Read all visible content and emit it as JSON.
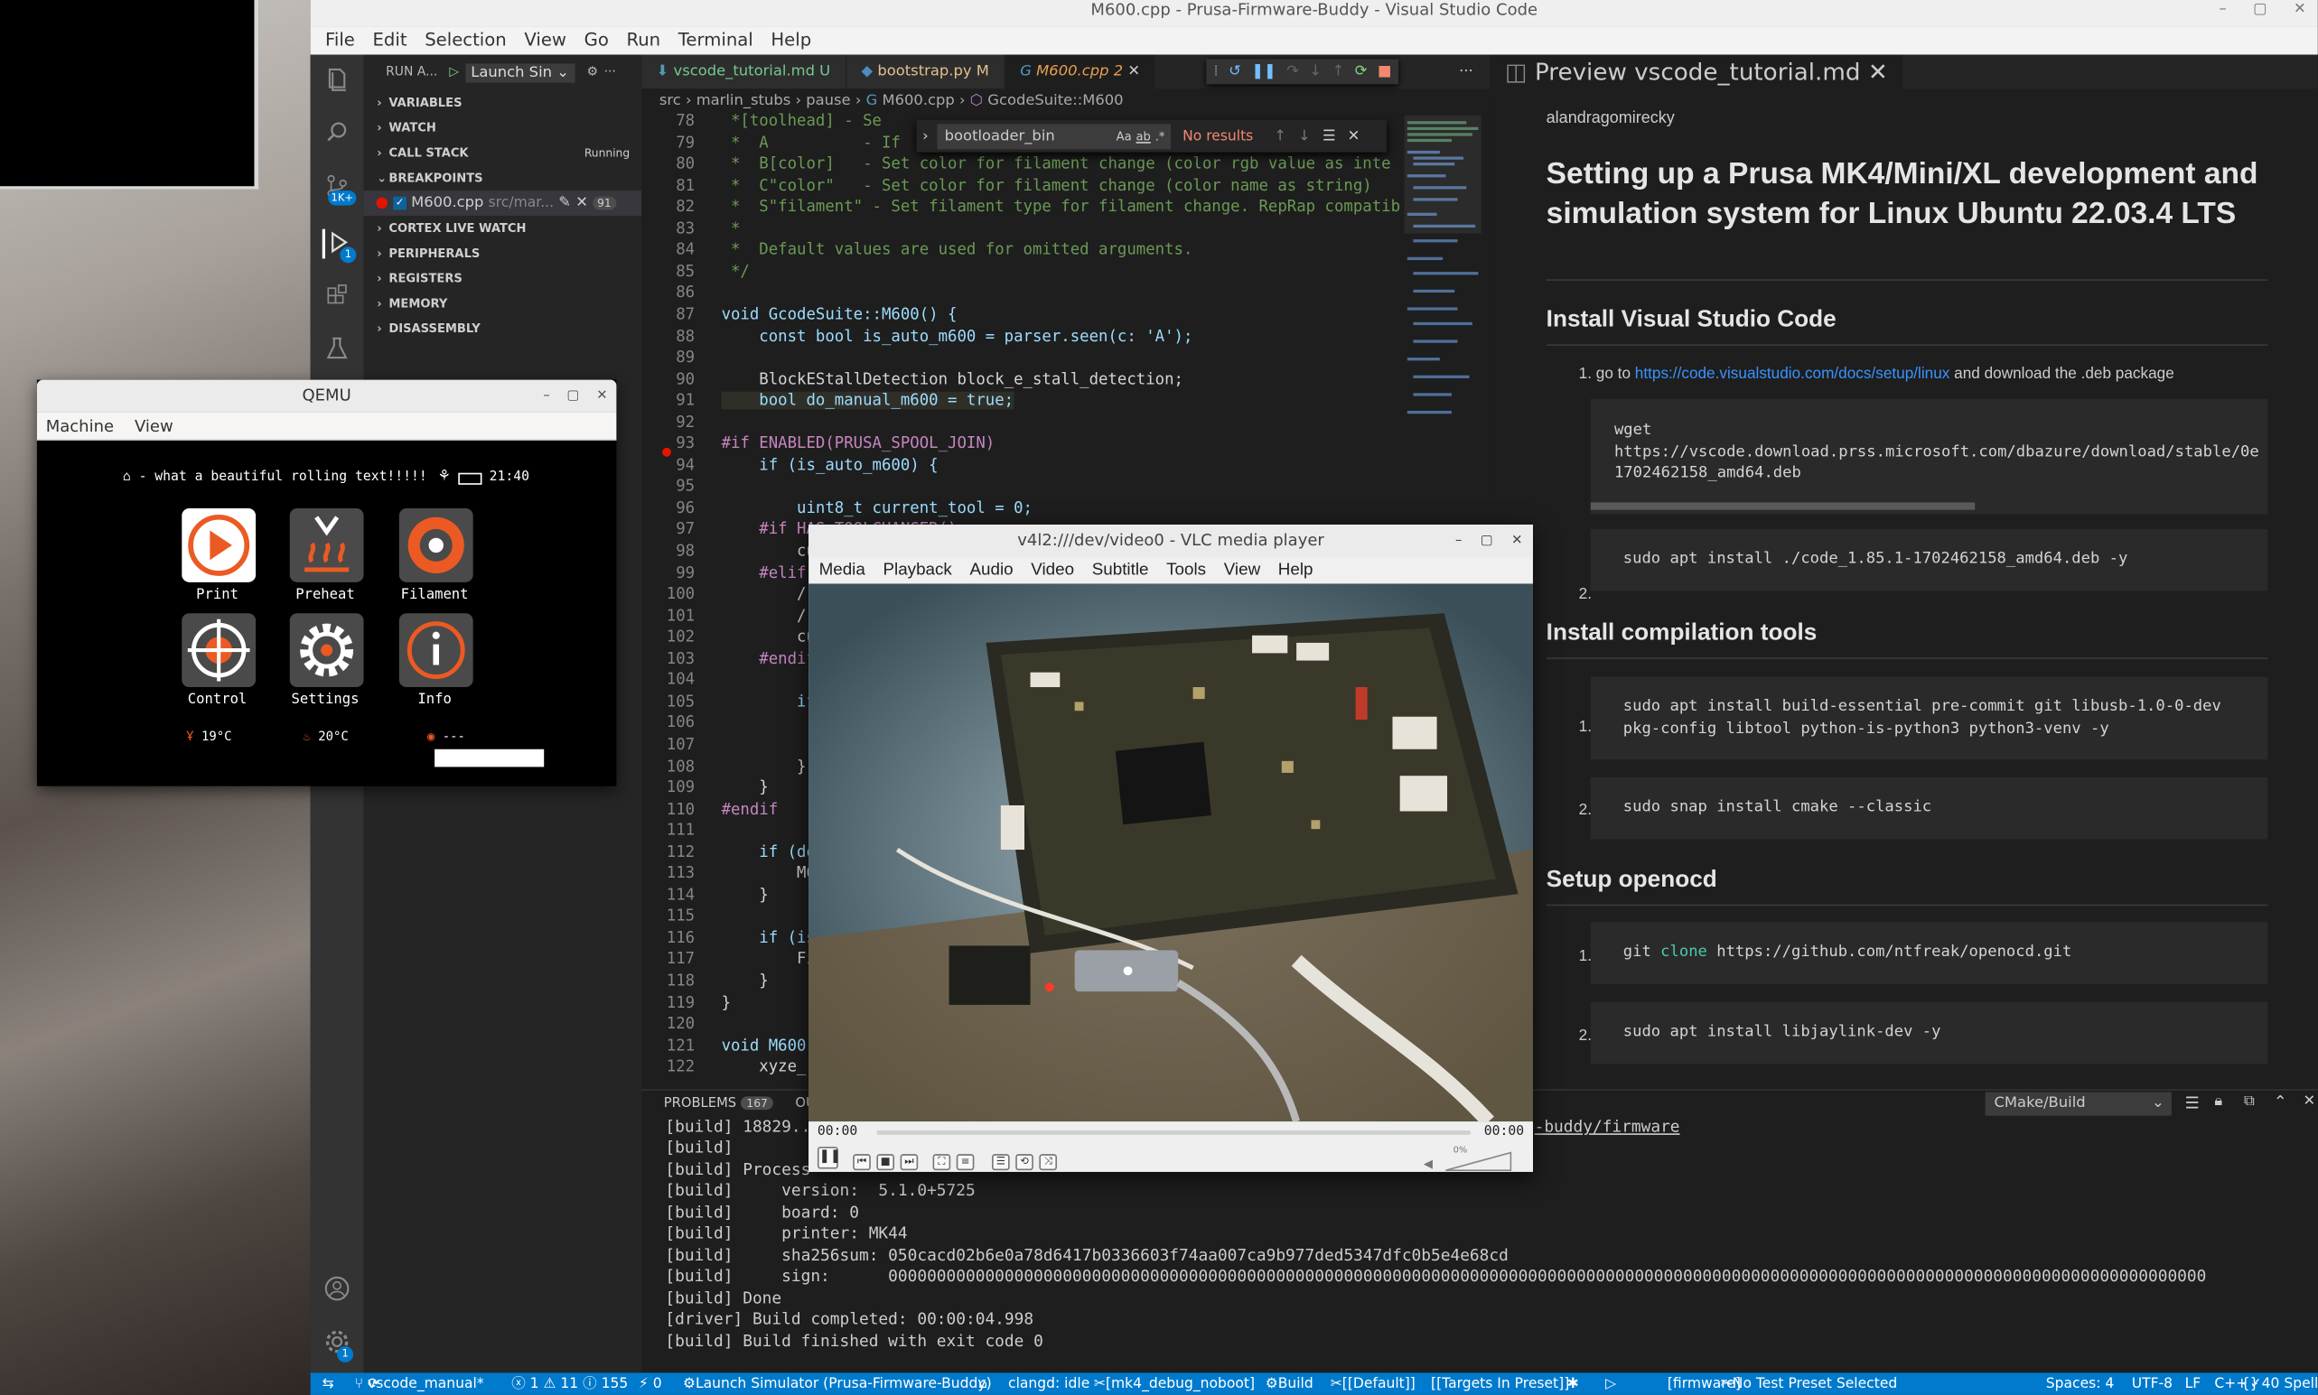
{
  "desktop_windows": [
    "QEMU",
    "v4l2:///dev/video0 - VLC media player"
  ],
  "vscode": {
    "title": "M600.cpp - Prusa-Firmware-Buddy - Visual Studio Code",
    "menu": [
      "File",
      "Edit",
      "Selection",
      "View",
      "Go",
      "Run",
      "Terminal",
      "Help"
    ],
    "activity_badges": {
      "source_control": "1K+",
      "run_debug": "1",
      "settings": "1"
    },
    "run_header": {
      "label": "RUN A...",
      "config": "Launch Sin"
    },
    "sidebar": {
      "sections": [
        "VARIABLES",
        "WATCH",
        "CALL STACK",
        "BREAKPOINTS",
        "CORTEX LIVE WATCH",
        "PERIPHERALS",
        "REGISTERS",
        "MEMORY",
        "DISASSEMBLY"
      ],
      "call_stack_status": "Running",
      "breakpoint": {
        "file": "M600.cpp",
        "path": "src/mar...",
        "line": "91"
      }
    },
    "tabs": [
      {
        "label": "vscode_tutorial.md",
        "status": "U"
      },
      {
        "label": "bootstrap.py",
        "status": "M"
      },
      {
        "label": "M600.cpp",
        "status": "2"
      }
    ],
    "breadcrumbs": [
      "src",
      "marlin_stubs",
      "pause",
      "M600.cpp",
      "GcodeSuite::M600"
    ],
    "find_widget": {
      "value": "bootloader_bin",
      "options": [
        "Aa",
        "ab",
        ".*"
      ],
      "result": "No results"
    },
    "code_lines": [
      {
        "n": "78",
        "t": " *[toolhead] - Se"
      },
      {
        "n": "79",
        "t": " *  A          - If"
      },
      {
        "n": "80",
        "t": " *  B[color]   - Set color for filament change (color rgb value as inte"
      },
      {
        "n": "81",
        "t": " *  C\"color\"   - Set color for filament change (color name as string)"
      },
      {
        "n": "82",
        "t": " *  S\"filament\" - Set filament type for filament change. RepRap compatib"
      },
      {
        "n": "83",
        "t": " *"
      },
      {
        "n": "84",
        "t": " *  Default values are used for omitted arguments."
      },
      {
        "n": "85",
        "t": " */"
      },
      {
        "n": "86",
        "t": ""
      },
      {
        "n": "87",
        "t": "void GcodeSuite::M600() {"
      },
      {
        "n": "88",
        "t": "    const bool is_auto_m600 = parser.seen(c: 'A');"
      },
      {
        "n": "89",
        "t": ""
      },
      {
        "n": "90",
        "t": "    BlockEStallDetection block_e_stall_detection;"
      },
      {
        "n": "91",
        "t": "    bool do_manual_m600 = true;"
      },
      {
        "n": "92",
        "t": ""
      },
      {
        "n": "93",
        "t": "#if ENABLED(PRUSA_SPOOL_JOIN)"
      },
      {
        "n": "94",
        "t": "    if (is_auto_m600) {"
      },
      {
        "n": "95",
        "t": ""
      },
      {
        "n": "96",
        "t": "        uint8_t current_tool = 0;"
      },
      {
        "n": "97",
        "t": "    #if HAS_TOOLCHANGER()"
      },
      {
        "n": "98",
        "t": "        cu"
      },
      {
        "n": "99",
        "t": "    #elif"
      },
      {
        "n": "100",
        "t": "        /"
      },
      {
        "n": "101",
        "t": "        /"
      },
      {
        "n": "102",
        "t": "        cu"
      },
      {
        "n": "103",
        "t": "    #endif"
      },
      {
        "n": "104",
        "t": ""
      },
      {
        "n": "105",
        "t": "        if"
      },
      {
        "n": "106",
        "t": ""
      },
      {
        "n": "107",
        "t": ""
      },
      {
        "n": "108",
        "t": "        }"
      },
      {
        "n": "109",
        "t": "    }"
      },
      {
        "n": "110",
        "t": "#endif"
      },
      {
        "n": "111",
        "t": ""
      },
      {
        "n": "112",
        "t": "    if (do"
      },
      {
        "n": "113",
        "t": "        M6"
      },
      {
        "n": "114",
        "t": "    }"
      },
      {
        "n": "115",
        "t": ""
      },
      {
        "n": "116",
        "t": "    if (is"
      },
      {
        "n": "117",
        "t": "        Fi"
      },
      {
        "n": "118",
        "t": "    }"
      },
      {
        "n": "119",
        "t": "}"
      },
      {
        "n": "120",
        "t": ""
      },
      {
        "n": "121",
        "t": "void M600"
      },
      {
        "n": "122",
        "t": "    xyze_"
      }
    ],
    "preview": {
      "tab": "Preview vscode_tutorial.md",
      "author": "alandragomirecky",
      "h1": "Setting up a Prusa MK4/Mini/XL development and simulation system for Linux Ubuntu 22.03.4 LTS",
      "s1": "Install Visual Studio Code",
      "s1_item1_prefix": "1. go to ",
      "s1_item1_link": "https://code.visualstudio.com/docs/setup/linux",
      "s1_item1_suffix": " and download the .deb package",
      "s1_code1": "wget\nhttps://vscode.download.prss.microsoft.com/dbazure/download/stable/0e\n1702462158_amd64.deb",
      "s1_code2": "sudo apt install ./code_1.85.1-1702462158_amd64.deb -y",
      "s2": "Install compilation tools",
      "s2_code1": "sudo apt install build-essential pre-commit git libusb-1.0-0-dev\npkg-config libtool python-is-python3 python3-venv -y",
      "s2_code2": "sudo snap install cmake --classic",
      "s3": "Setup openocd",
      "s3_code1a": "git ",
      "s3_code1b": "clone",
      "s3_code1c": " https://github.com/ntfreak/openocd.git",
      "s3_code2": "sudo apt install libjaylink-dev -y",
      "num1": "1.",
      "num2": "2."
    },
    "panel": {
      "tabs": [
        "PROBLEMS",
        "OU"
      ],
      "problems_count": "167",
      "task": "CMake/Build",
      "terminal_head": "[build] 18829...",
      "terminal_tail_link": "-buddy/firmware",
      "terminal": [
        "[build]",
        "[build] Process",
        "[build]     version:  5.1.0+5725",
        "[build]     board: 0",
        "[build]     printer: MK44",
        "[build]     sha256sum: 050cacd02b6e0a78d6417b0336603f74aa007ca9b977ded5347dfc0b5e4e68cd",
        "[build]     sign:      0000000000000000000000000000000000000000000000000000000000000000000000000000000000000000000000000000000000000000000000000000000000000000",
        "[build] Done",
        "[driver] Build completed: 00:00:04.998",
        "[build] Build finished with exit code 0"
      ]
    },
    "statusbar": {
      "branch": "vscode_manual*",
      "problems": "ⓧ 1 ⚠ 11 ⓘ 155",
      "ports": "⚡ 0",
      "launch": "Launch Simulator (Prusa-Firmware-Buddy)",
      "clangd": "clangd: idle",
      "kit": "[mk4_debug_noboot]",
      "build": "Build",
      "default": "[[Default]]",
      "targets": "[[Targets In Preset]]",
      "firmware": "[firmware]",
      "test": "No Test Preset Selected",
      "spaces": "Spaces: 4",
      "encoding": "UTF-8",
      "eol": "LF",
      "lang": "C++",
      "spell": "40 Spell"
    }
  },
  "qemu": {
    "title": "QEMU",
    "menu": [
      "Machine",
      "View"
    ],
    "header_text": "- what a beautiful rolling text!!!!!",
    "time": "21:40",
    "icons": [
      "Print",
      "Preheat",
      "Filament",
      "Control",
      "Settings",
      "Info"
    ],
    "temps": [
      "19°C",
      "20°C",
      "---"
    ]
  },
  "vlc": {
    "title": "v4l2:///dev/video0 - VLC media player",
    "menu": [
      "Media",
      "Playback",
      "Audio",
      "Video",
      "Subtitle",
      "Tools",
      "View",
      "Help"
    ],
    "time_start": "00:00",
    "time_end": "00:00",
    "volume": "0%"
  },
  "colors": {
    "vscode_accent": "#007acc",
    "link": "#3794ff",
    "breakpoint": "#e51400"
  }
}
